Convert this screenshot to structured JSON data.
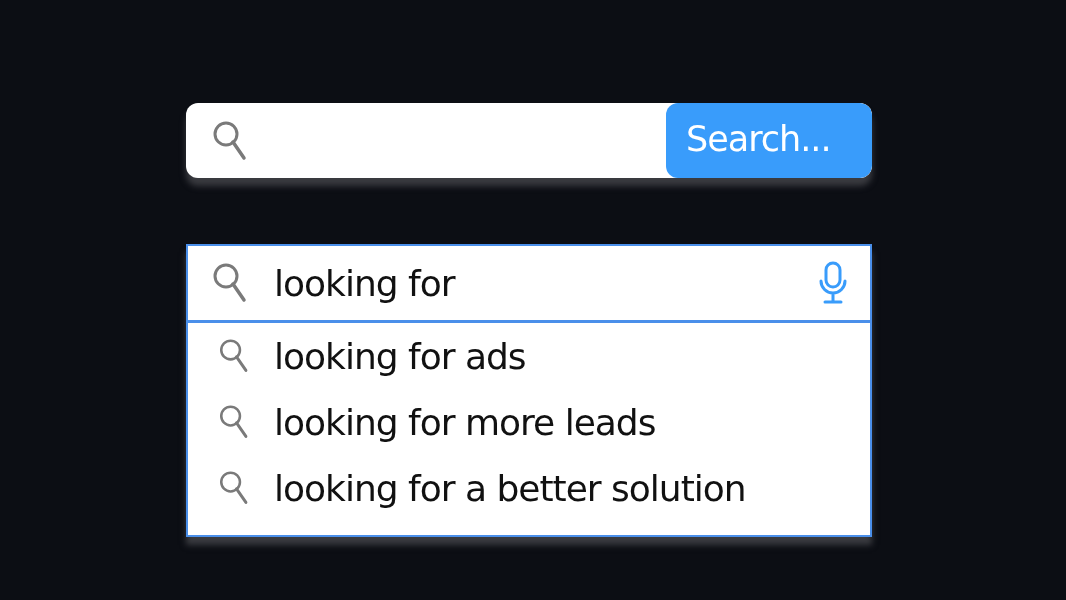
{
  "search_bar": {
    "button": "Search..."
  },
  "autocomplete": {
    "query": "looking for",
    "suggestions": [
      {
        "text": "looking for ads"
      },
      {
        "text": "looking for more leads"
      },
      {
        "text": "looking for a better solution"
      }
    ]
  }
}
